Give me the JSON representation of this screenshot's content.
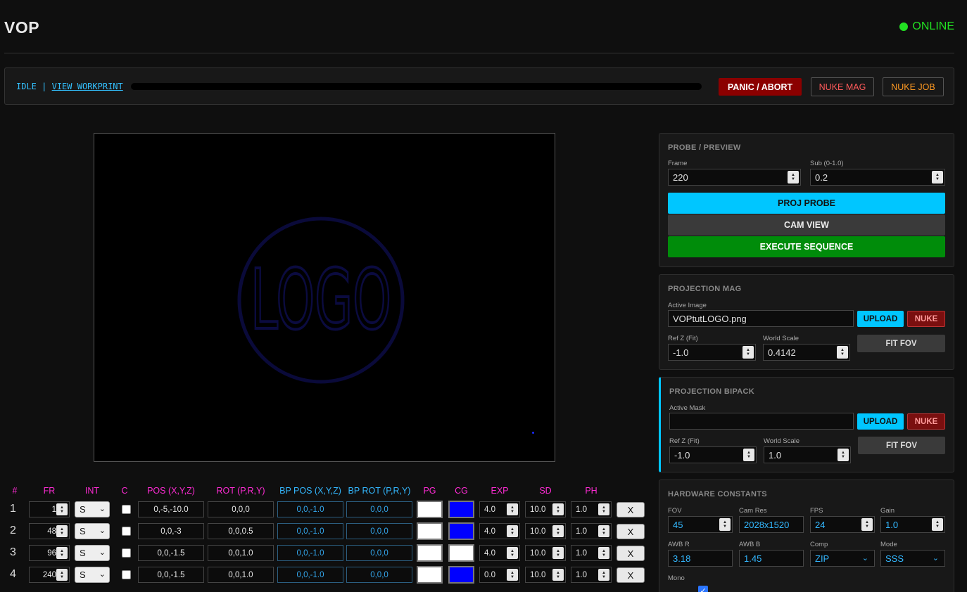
{
  "header": {
    "title": "VOP",
    "status": "ONLINE"
  },
  "statusbar": {
    "state": "IDLE",
    "separator": "|",
    "link": "VIEW WORKPRINT",
    "progress": 0,
    "panic": "PANIC / ABORT",
    "nuke_mag": "NUKE MAG",
    "nuke_job": "NUKE JOB"
  },
  "viewport": {
    "logo_text": "LOGO"
  },
  "probe": {
    "title": "PROBE / PREVIEW",
    "frame_label": "Frame",
    "frame_value": "220",
    "sub_label": "Sub (0-1.0)",
    "sub_value": "0.2",
    "proj_probe": "PROJ PROBE",
    "cam_view": "CAM VIEW",
    "execute": "EXECUTE SEQUENCE"
  },
  "mag": {
    "title": "PROJECTION MAG",
    "active_label": "Active Image",
    "active_value": "VOPtutLOGO.png",
    "upload": "UPLOAD",
    "nuke": "NUKE",
    "refz_label": "Ref Z (Fit)",
    "refz_value": "-1.0",
    "scale_label": "World Scale",
    "scale_value": "0.4142",
    "fit": "FIT FOV"
  },
  "bipack": {
    "title": "PROJECTION BIPACK",
    "active_label": "Active Mask",
    "active_value": "",
    "upload": "UPLOAD",
    "nuke": "NUKE",
    "refz_label": "Ref Z (Fit)",
    "refz_value": "-1.0",
    "scale_label": "World Scale",
    "scale_value": "1.0",
    "fit": "FIT FOV"
  },
  "hardware": {
    "title": "HARDWARE CONSTANTS",
    "fov_label": "FOV",
    "fov_value": "45",
    "res_label": "Cam Res",
    "res_value": "2028x1520",
    "fps_label": "FPS",
    "fps_value": "24",
    "gain_label": "Gain",
    "gain_value": "1.0",
    "awbr_label": "AWB R",
    "awbr_value": "3.18",
    "awbb_label": "AWB B",
    "awbb_value": "1.45",
    "comp_label": "Comp",
    "comp_value": "ZIP",
    "mode_label": "Mode",
    "mode_value": "SSS",
    "mono_label": "Mono",
    "mono_checked": true
  },
  "table": {
    "headers": [
      "#",
      "FR",
      "INT",
      "C",
      "POS (X,Y,Z)",
      "ROT (P,R,Y)",
      "BP POS (X,Y,Z)",
      "BP ROT (P,R,Y)",
      "PG",
      "CG",
      "EXP",
      "SD",
      "PH"
    ],
    "rows": [
      {
        "num": "1",
        "fr": "1",
        "int": "S",
        "pos": "0,-5,-10.0",
        "rot": "0,0,0",
        "bp_pos": "0,0,-1.0",
        "bp_rot": "0,0,0",
        "pg": "#ffffff",
        "cg": "#0000ff",
        "exp": "4.0",
        "sd": "10.0",
        "ph": "1.0",
        "x": "X"
      },
      {
        "num": "2",
        "fr": "48",
        "int": "S",
        "pos": "0,0,-3",
        "rot": "0,0,0.5",
        "bp_pos": "0,0,-1.0",
        "bp_rot": "0,0,0",
        "pg": "#ffffff",
        "cg": "#0000ff",
        "exp": "4.0",
        "sd": "10.0",
        "ph": "1.0",
        "x": "X"
      },
      {
        "num": "3",
        "fr": "96",
        "int": "S",
        "pos": "0,0,-1.5",
        "rot": "0,0,1.0",
        "bp_pos": "0,0,-1.0",
        "bp_rot": "0,0,0",
        "pg": "#ffffff",
        "cg": "#ffffff",
        "exp": "4.0",
        "sd": "10.0",
        "ph": "1.0",
        "x": "X"
      },
      {
        "num": "4",
        "fr": "240",
        "int": "S",
        "pos": "0,0,-1.5",
        "rot": "0,0,1.0",
        "bp_pos": "0,0,-1.0",
        "bp_rot": "0,0,0",
        "pg": "#ffffff",
        "cg": "#0000ff",
        "exp": "0.0",
        "sd": "10.0",
        "ph": "1.0",
        "x": "X"
      }
    ]
  },
  "colors": {
    "accent": "#00c6ff",
    "online": "#22e022",
    "pink": "#ff2bd5",
    "execute": "#008c0a",
    "panic": "#8b0000"
  }
}
